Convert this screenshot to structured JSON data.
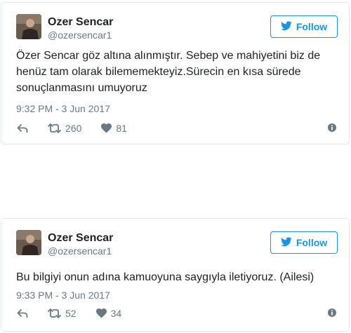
{
  "tweets": [
    {
      "name": "Ozer Sencar",
      "handle": "@ozersencar1",
      "follow_label": "Follow",
      "text": "Özer Sencar göz altına alınmıştır. Sebep ve mahiyetini biz de henüz tam olarak bilememekteyiz.Sürecin en kısa sürede sonuçlanmasını umuyoruz",
      "timestamp": "9:32 PM - 3 Jun 2017",
      "retweets": "260",
      "likes": "81"
    },
    {
      "name": "Ozer Sencar",
      "handle": "@ozersencar1",
      "follow_label": "Follow",
      "text": "Bu bilgiyi onun adına kamuoyuna saygıyla iletiyoruz. (Ailesi)",
      "timestamp": "9:33 PM - 3 Jun 2017",
      "retweets": "52",
      "likes": "34"
    }
  ],
  "icons": {
    "follow": "twitter-bird-icon",
    "reply": "reply-icon",
    "retweet": "retweet-icon",
    "like": "heart-icon",
    "info": "info-icon"
  },
  "colors": {
    "accent": "#1b95e0",
    "muted": "#697882",
    "border": "#e1e8ed"
  }
}
